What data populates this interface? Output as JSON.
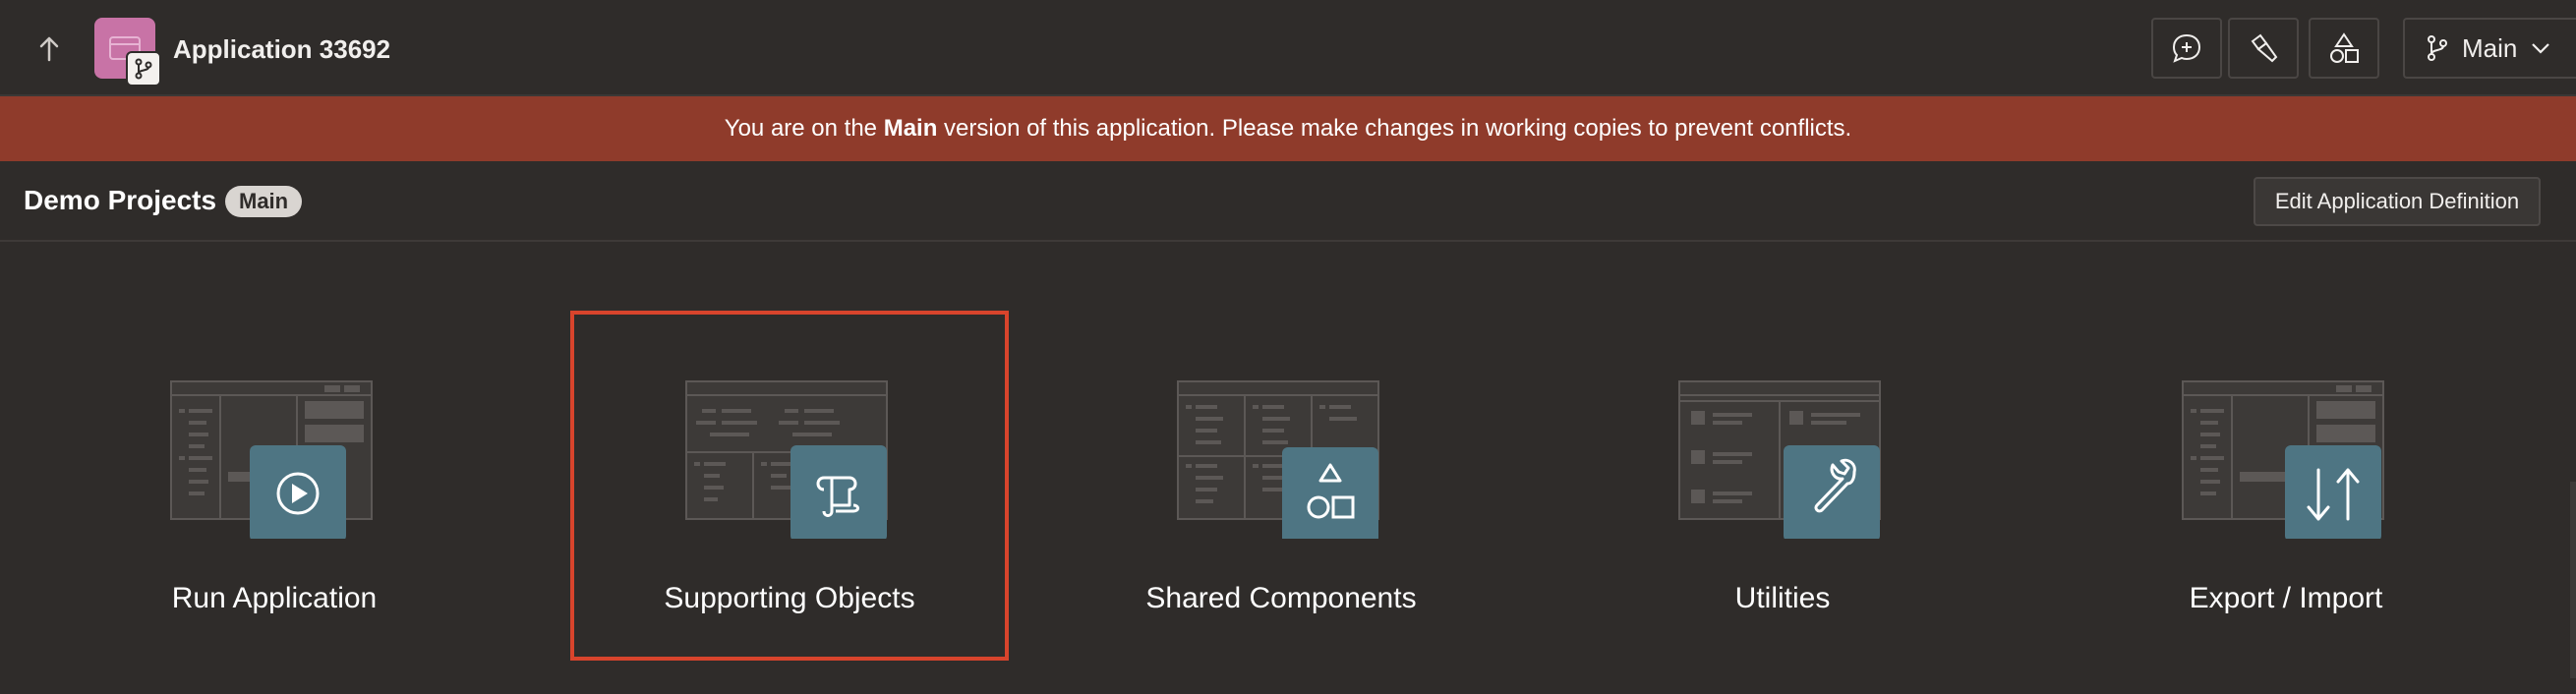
{
  "topbar": {
    "app_title": "Application 33692",
    "branch_label": "Main"
  },
  "banner": {
    "prefix": "You are on the ",
    "bold": "Main",
    "suffix": " version of this application. Please make changes in working copies to prevent conflicts."
  },
  "header": {
    "page_title": "Demo Projects",
    "badge": "Main",
    "edit_button": "Edit Application Definition"
  },
  "tiles": [
    {
      "label": "Run Application",
      "icon": "play-icon"
    },
    {
      "label": "Supporting Objects",
      "icon": "scroll-icon",
      "selected": true
    },
    {
      "label": "Shared Components",
      "icon": "shapes-icon"
    },
    {
      "label": "Utilities",
      "icon": "wrench-icon"
    },
    {
      "label": "Export / Import",
      "icon": "arrows-updown-icon"
    }
  ],
  "colors": {
    "background": "#2f2c2a",
    "banner": "#8f3b2b",
    "tile_icon_bg": "#4e7583",
    "selection": "#d8442c",
    "app_icon": "#c873a6"
  }
}
